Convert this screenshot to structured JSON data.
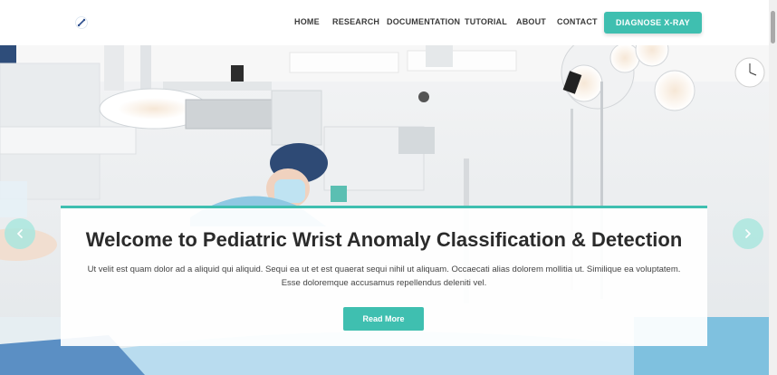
{
  "header": {
    "logo_icon": "bone-logo-icon",
    "nav": [
      {
        "label": "HOME"
      },
      {
        "label": "RESEARCH"
      },
      {
        "label": "DOCUMENTATION"
      },
      {
        "label": "TUTORIAL"
      },
      {
        "label": "ABOUT"
      },
      {
        "label": "CONTACT"
      }
    ],
    "cta_label": "DIAGNOSE X-RAY"
  },
  "hero": {
    "title": "Welcome to Pediatric Wrist Anomaly Classification & Detection",
    "body_line1": "Ut velit est quam dolor ad a aliquid qui aliquid. Sequi ea ut et est quaerat sequi nihil ut aliquam. Occaecati alias dolorem mollitia ut. Similique ea voluptatem.",
    "body_line2": "Esse doloremque accusamus repellendus deleniti vel.",
    "button_label": "Read More",
    "prev_icon": "chevron-left-icon",
    "next_icon": "chevron-right-icon"
  },
  "colors": {
    "accent": "#3fbfb0",
    "arrow_bg": "#aae6de",
    "title_text": "#2b2b2b"
  }
}
